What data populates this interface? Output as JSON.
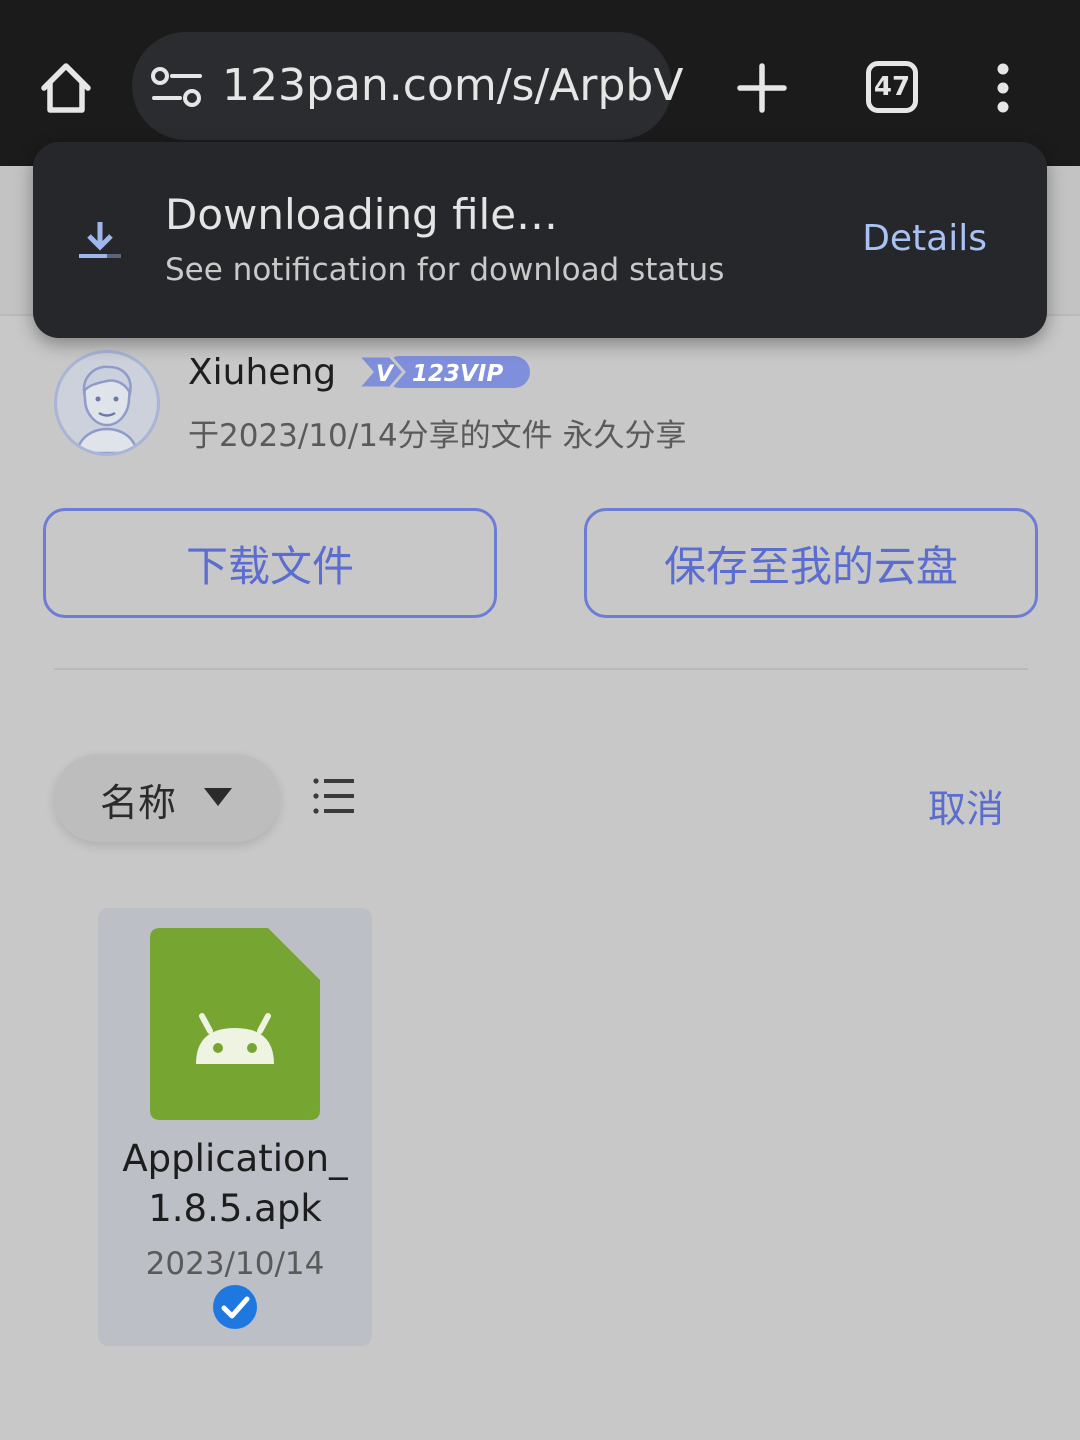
{
  "browser": {
    "url": "123pan.com/s/ArpbV",
    "tab_count": "47"
  },
  "snackbar": {
    "title": "Downloading file…",
    "subtitle": "See notification for download status",
    "action": "Details"
  },
  "share": {
    "user_name": "Xiuheng",
    "vip_badge": "123VIP",
    "info": "于2023/10/14分享的文件 永久分享"
  },
  "actions": {
    "download": "下载文件",
    "save": "保存至我的云盘"
  },
  "file_list": {
    "sort_label": "名称",
    "cancel": "取消",
    "files": [
      {
        "name": "Application_1.8.5.apk",
        "date": "2023/10/14",
        "selected": true
      }
    ]
  },
  "colors": {
    "accent": "#5b6ecf",
    "apk_green": "#76a631",
    "check_blue": "#1f78e0"
  }
}
